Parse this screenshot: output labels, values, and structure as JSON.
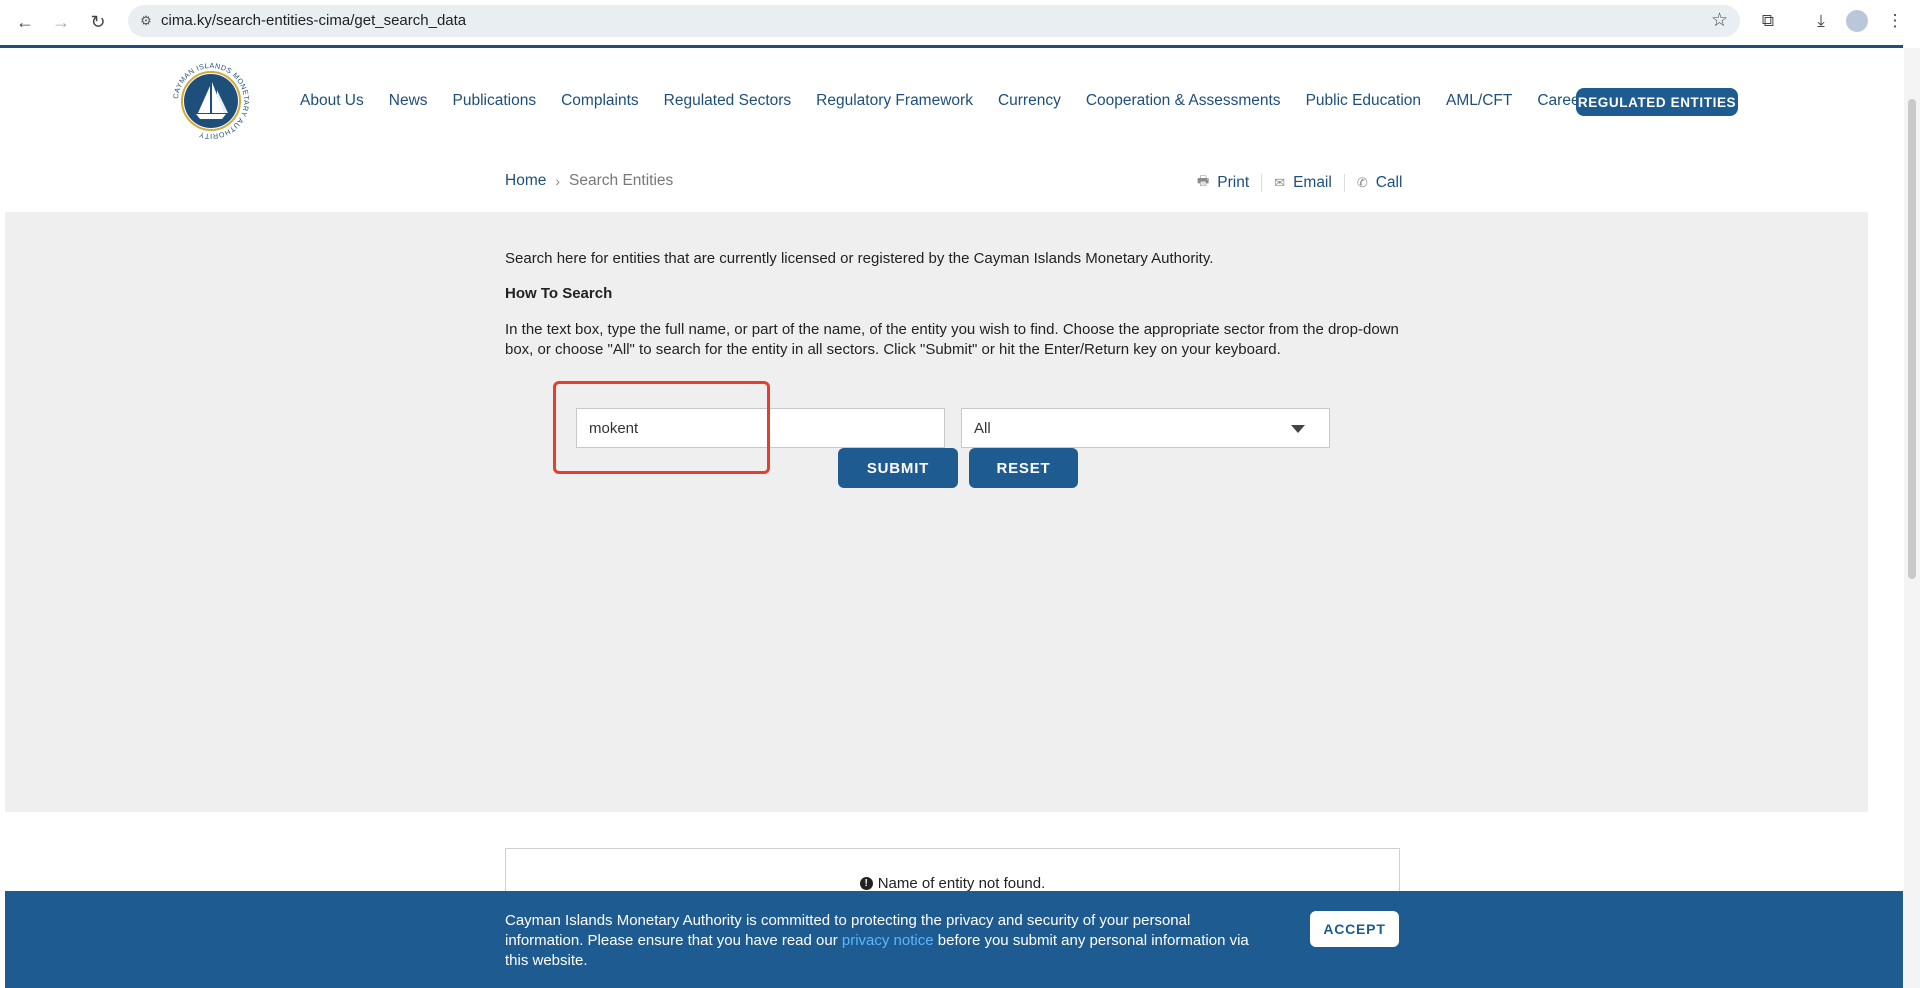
{
  "browser": {
    "url": "cima.ky/search-entities-cima/get_search_data",
    "back_icon": "arrow-left-icon",
    "forward_icon": "arrow-right-icon",
    "reload_icon": "reload-icon"
  },
  "header": {
    "logo_text": "CAYMAN ISLANDS MONETARY AUTHORITY",
    "nav": [
      "About Us",
      "News",
      "Publications",
      "Complaints",
      "Regulated Sectors",
      "Regulatory Framework",
      "Currency",
      "Cooperation & Assessments",
      "Public Education",
      "AML/CFT",
      "Careers"
    ],
    "regulated_button": "REGULATED ENTITIES"
  },
  "breadcrumb": {
    "home": "Home",
    "separator": "›",
    "current": "Search Entities"
  },
  "tools": {
    "print": "Print",
    "email": "Email",
    "call": "Call"
  },
  "search": {
    "intro": "Search here for entities that are currently licensed or registered by the Cayman Islands Monetary Authority.",
    "how_heading": "How To Search",
    "instructions": "In the text box, type the full name, or part of the name, of the entity you wish to find. Choose the appropriate sector from the drop-down box, or choose \"All\" to search for the entity in all sectors. Click \"Submit\" or hit the Enter/Return key on your keyboard.",
    "input_value": "mokent",
    "sector_selected": "All",
    "submit_label": "SUBMIT",
    "reset_label": "RESET"
  },
  "results": {
    "message": "Name of entity not found."
  },
  "cookie": {
    "text_before": "Cayman Islands Monetary Authority is committed to protecting the privacy and security of your personal information. Please ensure that you have read our ",
    "link_text": "privacy notice",
    "text_after": " before you submit any personal information via this website.",
    "accept_label": "ACCEPT"
  },
  "colors": {
    "brand": "#1e5b91",
    "highlight": "#e2402d",
    "section_bg": "#efefef"
  }
}
